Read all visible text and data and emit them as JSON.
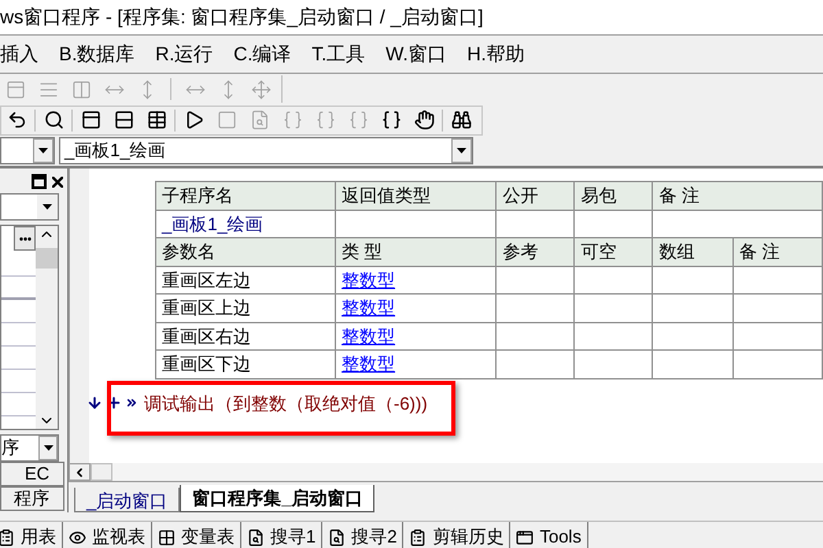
{
  "window": {
    "title": "ws窗口程序 - [程序集: 窗口程序集_启动窗口 / _启动窗口]"
  },
  "menu": [
    {
      "label": "插入"
    },
    {
      "label": "B.数据库"
    },
    {
      "label": "R.运行"
    },
    {
      "label": "C.编译"
    },
    {
      "label": "T.工具"
    },
    {
      "label": "W.窗口"
    },
    {
      "label": "H.帮助"
    }
  ],
  "procedure_combo": {
    "value": "_画板1_绘画"
  },
  "left_panel": {
    "items": [
      {
        "label": "序",
        "kind": "dropdown"
      },
      {
        "label": "EC",
        "kind": "button"
      },
      {
        "label": "程序",
        "kind": "button"
      }
    ]
  },
  "sub_table": {
    "header": [
      "子程序名",
      "返回值类型",
      "公开",
      "易包",
      "备 注"
    ],
    "name": "_画板1_绘画",
    "param_header": [
      "参数名",
      "类 型",
      "参考",
      "可空",
      "数组",
      "备 注"
    ],
    "params": [
      {
        "name": "重画区左边",
        "type": "整数型"
      },
      {
        "name": "重画区上边",
        "type": "整数型"
      },
      {
        "name": "重画区右边",
        "type": "整数型"
      },
      {
        "name": "重画区下边",
        "type": "整数型"
      }
    ]
  },
  "code_line": "调试输出（到整数（取绝对值（-6)))",
  "tabs": [
    {
      "label": "_启动窗口",
      "selected": false
    },
    {
      "label": "窗口程序集_启动窗口",
      "selected": true
    }
  ],
  "bottom_tabs": [
    {
      "label": "用表"
    },
    {
      "label": "监视表"
    },
    {
      "label": "变量表"
    },
    {
      "label": "搜寻1"
    },
    {
      "label": "搜寻2"
    },
    {
      "label": "剪辑历史"
    },
    {
      "label": "Tools"
    }
  ]
}
